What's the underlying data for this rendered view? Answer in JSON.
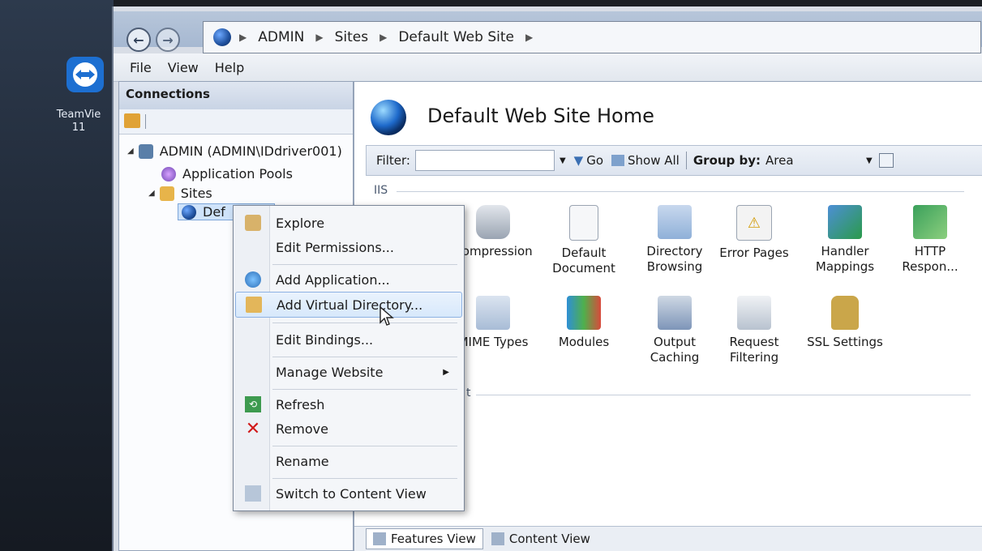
{
  "desktop": {
    "teamviewer_label": "TeamVie\n11"
  },
  "address": {
    "crumbs": [
      "ADMIN",
      "Sites",
      "Default Web Site"
    ]
  },
  "menubar": {
    "items": [
      "File",
      "View",
      "Help"
    ]
  },
  "connections": {
    "title": "Connections",
    "tree": {
      "server": "ADMIN (ADMIN\\IDdriver001)",
      "app_pools": "Application Pools",
      "sites": "Sites",
      "site": "Def"
    }
  },
  "main": {
    "title": "Default Web Site Home",
    "filter_label": "Filter:",
    "go_label": "Go",
    "show_all_label": "Show All",
    "group_by_label": "Group by:",
    "group_by_value": "Area",
    "iis_label": "IIS",
    "features_row1": [
      "Compression",
      "Default\nDocument",
      "Directory\nBrowsing",
      "Error Pages",
      "Handler\nMappings",
      "HTTP\nRespon..."
    ],
    "features_row2": [
      "MIME Types",
      "Modules",
      "Output\nCaching",
      "Request\nFiltering",
      "SSL Settings"
    ],
    "management_fragment": "t",
    "features_view_label": "Features View",
    "content_view_label": "Content View"
  },
  "context_menu": {
    "explore": "Explore",
    "edit_permissions": "Edit Permissions...",
    "add_application": "Add Application...",
    "add_virtual_directory": "Add Virtual Directory...",
    "edit_bindings": "Edit Bindings...",
    "manage_website": "Manage Website",
    "refresh": "Refresh",
    "remove": "Remove",
    "rename": "Rename",
    "switch_content_view": "Switch to Content View"
  },
  "colors": {
    "highlight": "#d7e8fb",
    "remove_icon": "#d11a1a"
  }
}
